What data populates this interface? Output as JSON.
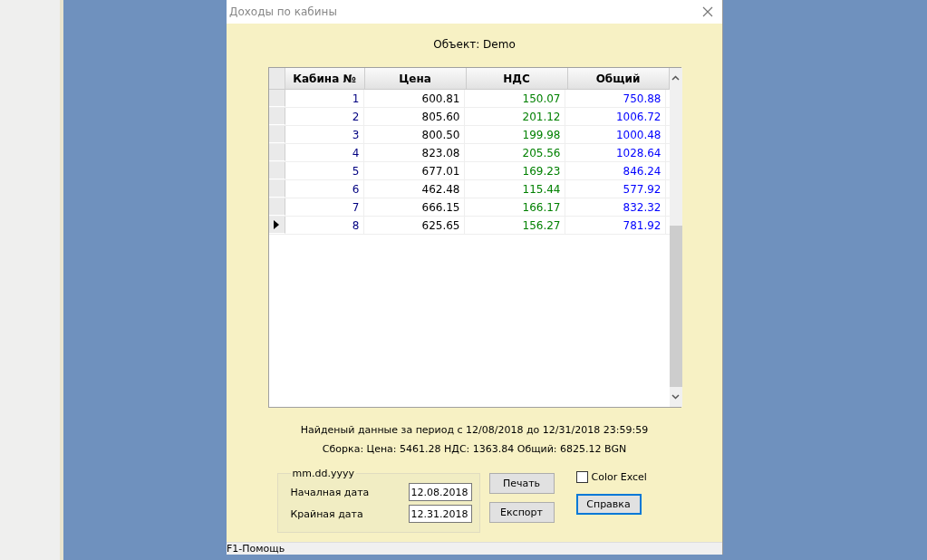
{
  "window": {
    "title": "Доходы по кабины"
  },
  "object_label": "Объект: Demo",
  "table": {
    "columns": [
      "Кабина №",
      "Цена",
      "НДС",
      "Общий"
    ],
    "rows": [
      {
        "cells": [
          "1",
          "600.81",
          "150.07",
          "750.88"
        ],
        "selected": false
      },
      {
        "cells": [
          "2",
          "805.60",
          "201.12",
          "1006.72"
        ],
        "selected": false
      },
      {
        "cells": [
          "3",
          "800.50",
          "199.98",
          "1000.48"
        ],
        "selected": false
      },
      {
        "cells": [
          "4",
          "823.08",
          "205.56",
          "1028.64"
        ],
        "selected": false
      },
      {
        "cells": [
          "5",
          "677.01",
          "169.23",
          "846.24"
        ],
        "selected": false
      },
      {
        "cells": [
          "6",
          "462.48",
          "115.44",
          "577.92"
        ],
        "selected": false
      },
      {
        "cells": [
          "7",
          "666.15",
          "166.17",
          "832.32"
        ],
        "selected": false
      },
      {
        "cells": [
          "8",
          "625.65",
          "156.27",
          "781.92"
        ],
        "selected": true
      }
    ]
  },
  "period_text": "Найденый данные за период с 12/08/2018  до 12/31/2018 23:59:59",
  "totals_text": "Сборка:  Цена: 5461.28   НДС: 1363.84  Общий: 6825.12 BGN",
  "date_group": {
    "legend": "mm.dd.yyyy",
    "fields": [
      {
        "label": "Началная дата",
        "value": "12.08.2018"
      },
      {
        "label": "Крайная дата",
        "value": "12.31.2018"
      }
    ]
  },
  "buttons": [
    {
      "label": "Печать",
      "focused": false
    },
    {
      "label": "Експорт",
      "focused": false
    },
    {
      "label": "Справка",
      "focused": true
    }
  ],
  "color_excel": {
    "label": "Color Excel",
    "checked": false
  },
  "status_bar": "F1-Помощь"
}
